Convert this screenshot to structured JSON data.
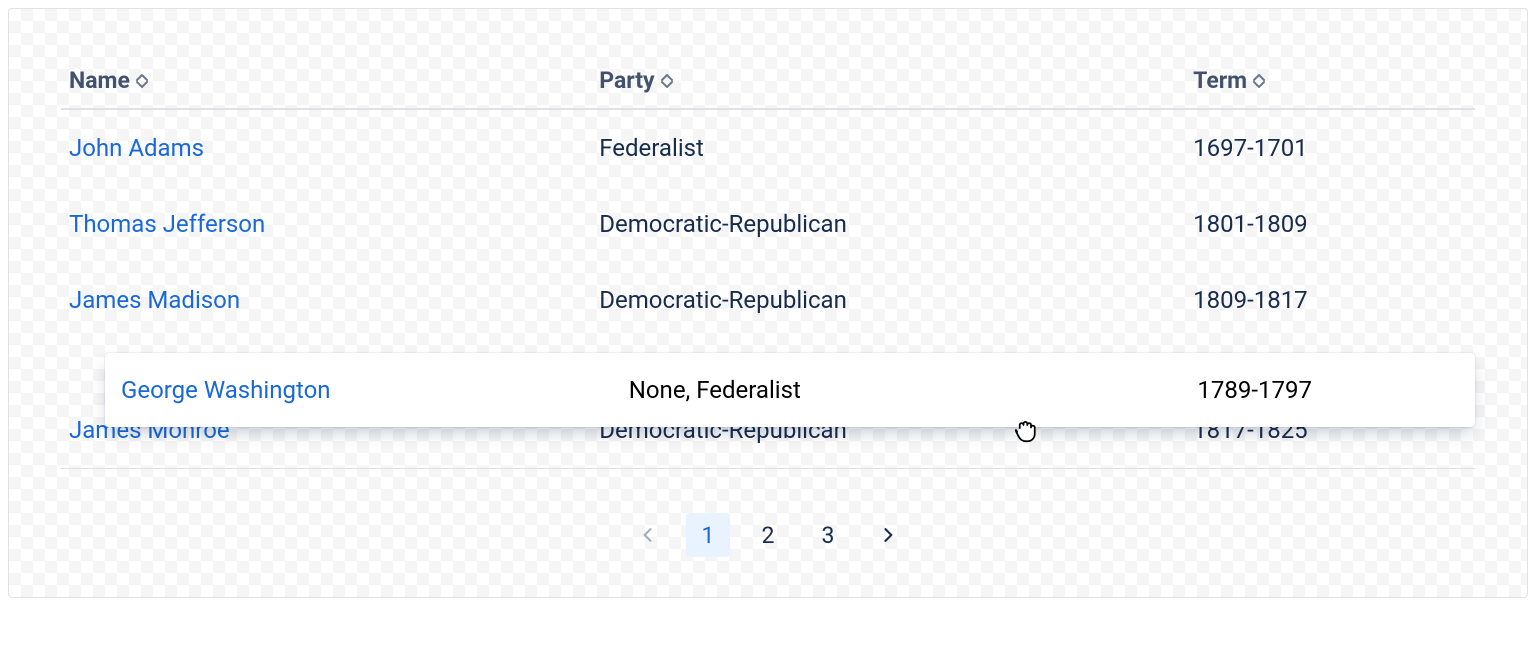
{
  "table": {
    "columns": {
      "name": "Name",
      "party": "Party",
      "term": "Term"
    },
    "rows": [
      {
        "name": "John Adams",
        "party": "Federalist",
        "term": "1697-1701"
      },
      {
        "name": "Thomas Jefferson",
        "party": "Democratic-Republican",
        "term": "1801-1809"
      },
      {
        "name": "James Madison",
        "party": "Democratic-Republican",
        "term": "1809-1817"
      },
      {
        "name": "James Monroe",
        "party": "Democratic-Republican",
        "term": "1817-1825"
      }
    ],
    "dragging_row": {
      "name": "George Washington",
      "party": "None, Federalist",
      "term": "1789-1797"
    }
  },
  "pagination": {
    "pages": [
      "1",
      "2",
      "3"
    ],
    "current": "1"
  }
}
